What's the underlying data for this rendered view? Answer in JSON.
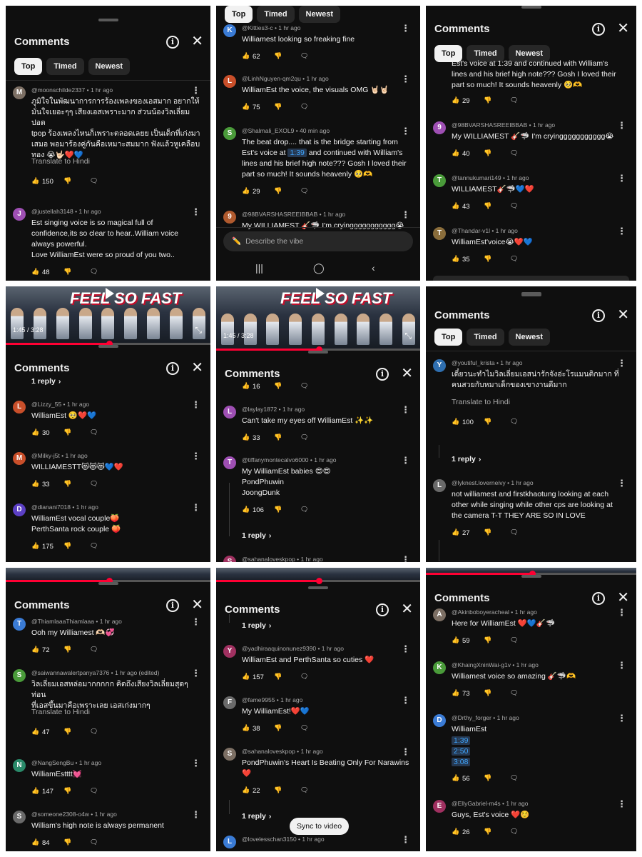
{
  "labels": {
    "comments": "Comments",
    "top": "Top",
    "timed": "Timed",
    "newest": "Newest",
    "translate": "Translate to Hindi",
    "one_reply": "1 reply",
    "describe_vibe": "Describe the vibe",
    "sync_to_video": "Sync to video",
    "video_time": "1:45 / 3:28"
  },
  "video": {
    "title_line1": "FEEL SO FAST",
    "played_fraction": 0.505
  },
  "colors": {
    "bg": "#0f0f0f",
    "chip_active": "#f1f1f1",
    "chip": "#272727",
    "text": "#f1f1f1",
    "meta": "#aaaaaa",
    "progress": "#ff0033",
    "timestamp_link": "#3ea6ff"
  },
  "panels": [
    {
      "comments": [
        {
          "user": "@moonschilde2337 • 1 hr ago",
          "text": "ภูมิใจในพัฒนาการการร้องเพลงของเอสมาก อยากให้\nมั่นใจเยอะๆๆ เสียงเอสเพราะมาก ส่วนน้องวิลเลี่ยมปอด\ntpop ร้องเพลงไหนก็เพราะตลอดเลยย เป็นเด็กที่เก่งมา\nเสมอ พอมาร้องคู่กันคือเหมาะสมมาก ฟังแล้วหูเคลือบ\nทอง 😭🤟🏻❤️💙",
          "translate": "Translate to Hindi",
          "likes": "150"
        },
        {
          "user": "@justellah3148 • 1 hr ago",
          "text": "Est singing voice is so magical full of\nconfidence,its so clear to hear..William voice\nalways powerful.\nLove WilliamEst were so proud of you two..",
          "likes": "48"
        }
      ]
    },
    {
      "comments": [
        {
          "user": "@Kitties3-c • 1 hr ago",
          "text": "Williamest looking so freaking fine",
          "likes": "62"
        },
        {
          "user": "@LinhNguyen-qm2qu • 1 hr ago",
          "text": "WilliamEst the voice, the visuals OMG 🤘🏻🤘🏻",
          "likes": "75"
        },
        {
          "user": "@Shalmali_EXOL9 • 40 min ago",
          "text_a": "The beat drop.... that is the bridge starting from\nEst's voice at ",
          "timestamp": "1:39",
          "text_b": " and continued with William's\nlines and his brief high note??? Gosh I loved their\npart so much! It sounds heavenly 🥺🫶",
          "likes": "29"
        },
        {
          "user": "@98BVARSHASREEIBBAB • 1 hr ago",
          "text": "My WILLIAMEST 🎸🦈 I'm cryinggggggggggg😭"
        }
      ]
    },
    {
      "partial_top": "Est's voice at 1:39 and continued with William's\nlines and his brief high note??? Gosh I loved their\npart so much! It sounds heavenly 🥺🫶",
      "partial_likes": "29",
      "comments": [
        {
          "user": "@98BVARSHASREEIBBAB • 1 hr ago",
          "text": "My WILLIAMEST 🎸🦈 I'm cryinggggggggggg😭",
          "likes": "40"
        },
        {
          "user": "@tannukumari149 • 1 hr ago",
          "text": "WILLIAMEST🎸🦈💙❤️",
          "likes": "43"
        },
        {
          "user": "@Thandar-v1l • 1 hr ago",
          "text": "WilliamEst'voice😭❤️💙",
          "likes": "35"
        }
      ]
    },
    {
      "comments": [
        {
          "user": "@Lizzy_55 • 1 hr ago",
          "text": "WilliamEst 🥺❤️💙",
          "likes": "30"
        },
        {
          "user": "@Milky-j5t • 1 hr ago",
          "text": "WILLIAMESTT😻😻😻💙❤️",
          "likes": "33"
        },
        {
          "user": "@dianani7018 • 1 hr ago",
          "text": "WilliamEst vocal couple🍑\nPerthSanta rock couple 🍑",
          "likes": "175"
        }
      ]
    },
    {
      "partial_likes": "16",
      "comments": [
        {
          "user": "@laylay1872 • 1 hr ago",
          "text": "Can't take my eyes off WilliamEst ✨✨",
          "likes": "33"
        },
        {
          "user": "@tiffanymontecalvo6000 • 1 hr ago",
          "text": "My WilliamEst babies 😍😍\nPondPhuwin\nJoongDunk",
          "likes": "106"
        },
        {
          "user": "@sahanaloveskpop • 1 hr ago"
        }
      ]
    },
    {
      "comments": [
        {
          "user": "@youtiful_krista • 1 hr ago",
          "text": "เดี๋ยวนะทำไมวิลเลี่ยมเอสน่ารักจังอ่ะโรแมนติกมาก ที่\nคนสวยกับหมาเด็กของเขางานดีมาก",
          "translate": "Translate to Hindi",
          "likes": "100"
        },
        {
          "user": "@lyknest.loverneivy • 1 hr ago",
          "text": "not williamest and firstkhaotung looking at each\nother while singing while other cps are looking at\nthe camera T-T THEY ARE SO IN LOVE",
          "likes": "27"
        }
      ]
    },
    {
      "comments": [
        {
          "user": "@ThiamlaaaThiamlaaa • 1 hr ago",
          "text": "Ooh my Williamest 🫶🏻💞",
          "likes": "72"
        },
        {
          "user": "@saiwannawalertpanya7376 • 1 hr ago (edited)",
          "text": "วิลเลี่ยมเอสหล่อมากกกกก คิดถึงเสียงวิลเลี่ยมสุดๆ ท่อน\nที่เอสขึ้นมาคือเพราะเลย เอสเก่งมากๆ",
          "translate": "Translate to Hindi",
          "likes": "47"
        },
        {
          "user": "@NangSengBu • 1 hr ago",
          "text": "WilliamEstttt💓",
          "likes": "147"
        },
        {
          "user": "@someone2308-o4w • 1 hr ago",
          "text": "William's high note is always permanent",
          "likes": "84"
        }
      ]
    },
    {
      "comments": [
        {
          "user": "@yadhiraaquinonunez9390 • 1 hr ago",
          "text": "WilliamEst and PerthSanta so cuties ❤️",
          "likes": "157"
        },
        {
          "user": "@fame9955 • 1 hr ago",
          "text": "My WilliamEst!❤️💙",
          "likes": "38"
        },
        {
          "user": "@sahanaloveskpop • 1 hr ago",
          "text": "PondPhuwin's Heart Is Beating Only For Narawins\n❤️",
          "likes": "22"
        },
        {
          "user": "@lovelesschan3150 • 1 hr ago"
        }
      ]
    },
    {
      "comments": [
        {
          "user": "@Akinboboyeracheal • 1 hr ago",
          "text": "Here for WilliamEst ❤️💙🎸🦈",
          "likes": "59"
        },
        {
          "user": "@KhaingXninWai-g1v • 1 hr ago",
          "text": "Williamest voice so amazing 🎸🦈🫶",
          "likes": "73"
        },
        {
          "user": "@Drthy_forger • 1 hr ago",
          "text": "WilliamEst",
          "timestamps": [
            "1:39",
            "2:50",
            "3:08"
          ],
          "likes": "56"
        },
        {
          "user": "@EllyGabriel-m4s • 1 hr ago",
          "text": "Guys, Est's voice ❤️☺️",
          "likes": "26"
        }
      ]
    }
  ]
}
